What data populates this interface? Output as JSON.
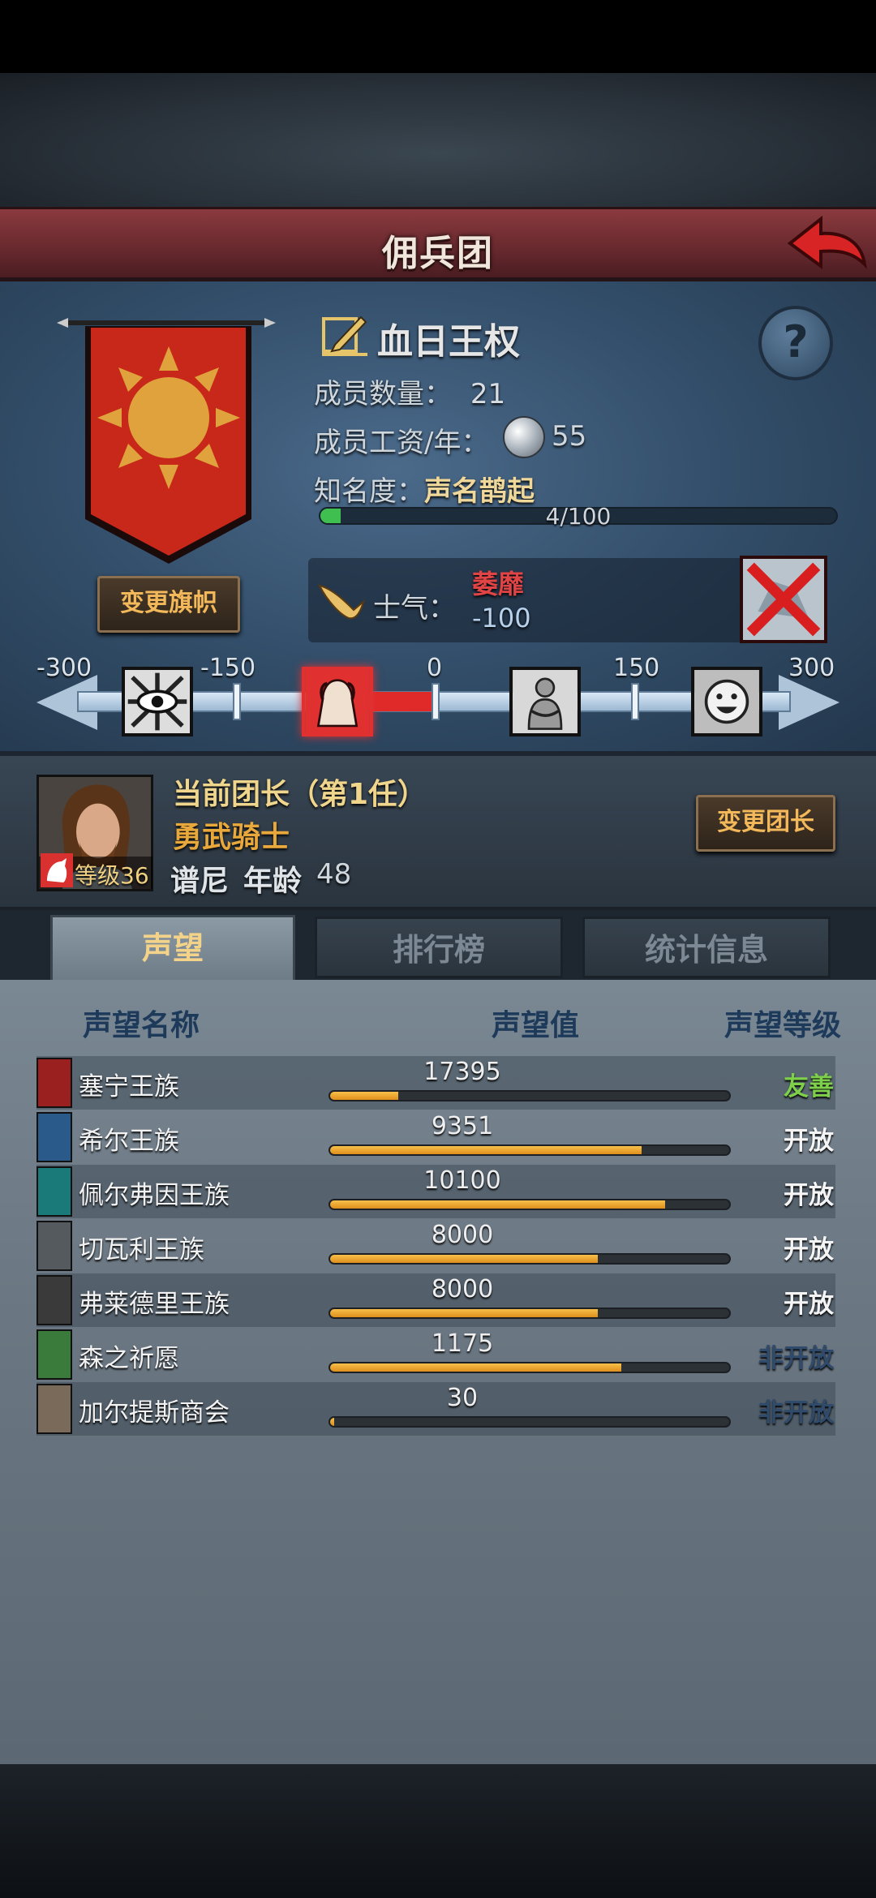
{
  "header": {
    "title": "佣兵团"
  },
  "guild": {
    "name": "血日王权",
    "member_label": "成员数量：",
    "member_count": "21",
    "wage_label": "成员工资/年：",
    "wage_value": "55",
    "fame_label": "知名度：",
    "fame_value": "声名鹊起",
    "fame_progress_text": "4/100",
    "fame_progress_fraction": 0.04,
    "change_flag_label": "变更旗帜",
    "help_label": "?"
  },
  "morale": {
    "label": "士气：",
    "state": "萎靡",
    "value": "-100",
    "scale_ticks": [
      "-300",
      "-150",
      "0",
      "150",
      "300"
    ],
    "icons": [
      "eye-madness-icon",
      "despair-icon",
      "hug-calm-icon",
      "happy-face-icon"
    ],
    "active_icon_index": 1
  },
  "leader": {
    "title": "当前团长（第1任）",
    "class": "勇武骑士",
    "name": "谱尼",
    "age_label": "年龄",
    "age": "48",
    "level_text": "等级36",
    "change_leader_label": "变更团长"
  },
  "tabs": [
    {
      "label": "声望",
      "active": true
    },
    {
      "label": "排行榜",
      "active": false
    },
    {
      "label": "统计信息",
      "active": false
    }
  ],
  "reputation": {
    "headers": {
      "name": "声望名称",
      "value": "声望值",
      "level": "声望等级"
    },
    "rows": [
      {
        "name": "塞宁王族",
        "value": "17395",
        "level": "友善",
        "fill": 0.17,
        "level_color": "#7ed04a",
        "icon_color": "#9a2020"
      },
      {
        "name": "希尔王族",
        "value": "9351",
        "level": "开放",
        "fill": 0.78,
        "level_color": "#f4f4f4",
        "icon_color": "#2a5a8a"
      },
      {
        "name": "佩尔弗因王族",
        "value": "10100",
        "level": "开放",
        "fill": 0.84,
        "level_color": "#f4f4f4",
        "icon_color": "#1a7a7a"
      },
      {
        "name": "切瓦利王族",
        "value": "8000",
        "level": "开放",
        "fill": 0.67,
        "level_color": "#f4f4f4",
        "icon_color": "#555a5e"
      },
      {
        "name": "弗莱德里王族",
        "value": "8000",
        "level": "开放",
        "fill": 0.67,
        "level_color": "#f4f4f4",
        "icon_color": "#3a3a3a"
      },
      {
        "name": "森之祈愿",
        "value": "1175",
        "level": "非开放",
        "fill": 0.73,
        "level_color": "#2f4a6a",
        "icon_color": "#3a7a3a"
      },
      {
        "name": "加尔提斯商会",
        "value": "30",
        "level": "非开放",
        "fill": 0.01,
        "level_color": "#2f4a6a",
        "icon_color": "#7a6a5a"
      }
    ]
  }
}
